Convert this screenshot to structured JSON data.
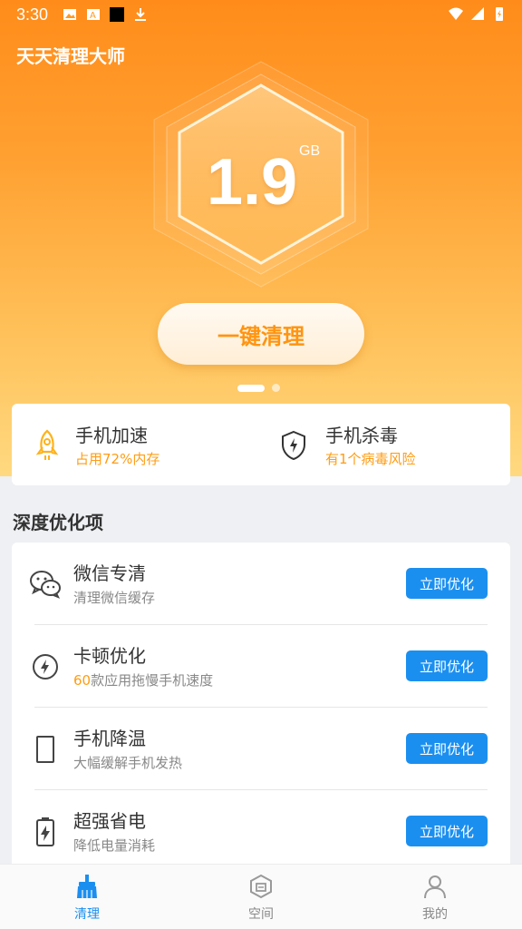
{
  "status_bar": {
    "time": "3:30"
  },
  "app": {
    "title": "天天清理大师"
  },
  "hero": {
    "value": "1.9",
    "unit": "GB",
    "clean_button": "一键清理"
  },
  "quick_actions": [
    {
      "title": "手机加速",
      "subtitle": "占用72%内存",
      "icon": "rocket-icon"
    },
    {
      "title": "手机杀毒",
      "subtitle": "有1个病毒风险",
      "icon": "shield-bolt-icon"
    }
  ],
  "section": {
    "title": "深度优化项"
  },
  "items": [
    {
      "title": "微信专清",
      "subtitle": "清理微信缓存",
      "button": "立即优化",
      "icon": "wechat-icon"
    },
    {
      "title": "卡顿优化",
      "subtitle_highlight": "60",
      "subtitle": "款应用拖慢手机速度",
      "button": "立即优化",
      "icon": "lightning-circle-icon"
    },
    {
      "title": "手机降温",
      "subtitle": "大幅缓解手机发热",
      "button": "立即优化",
      "icon": "phone-icon"
    },
    {
      "title": "超强省电",
      "subtitle": "降低电量消耗",
      "button": "立即优化",
      "icon": "battery-bolt-icon"
    }
  ],
  "bottom_nav": [
    {
      "label": "清理",
      "icon": "broom-icon",
      "active": true
    },
    {
      "label": "空间",
      "icon": "storage-icon",
      "active": false
    },
    {
      "label": "我的",
      "icon": "user-icon",
      "active": false
    }
  ],
  "colors": {
    "accent": "#ff9c13",
    "primary_blue": "#1b8ff0"
  }
}
